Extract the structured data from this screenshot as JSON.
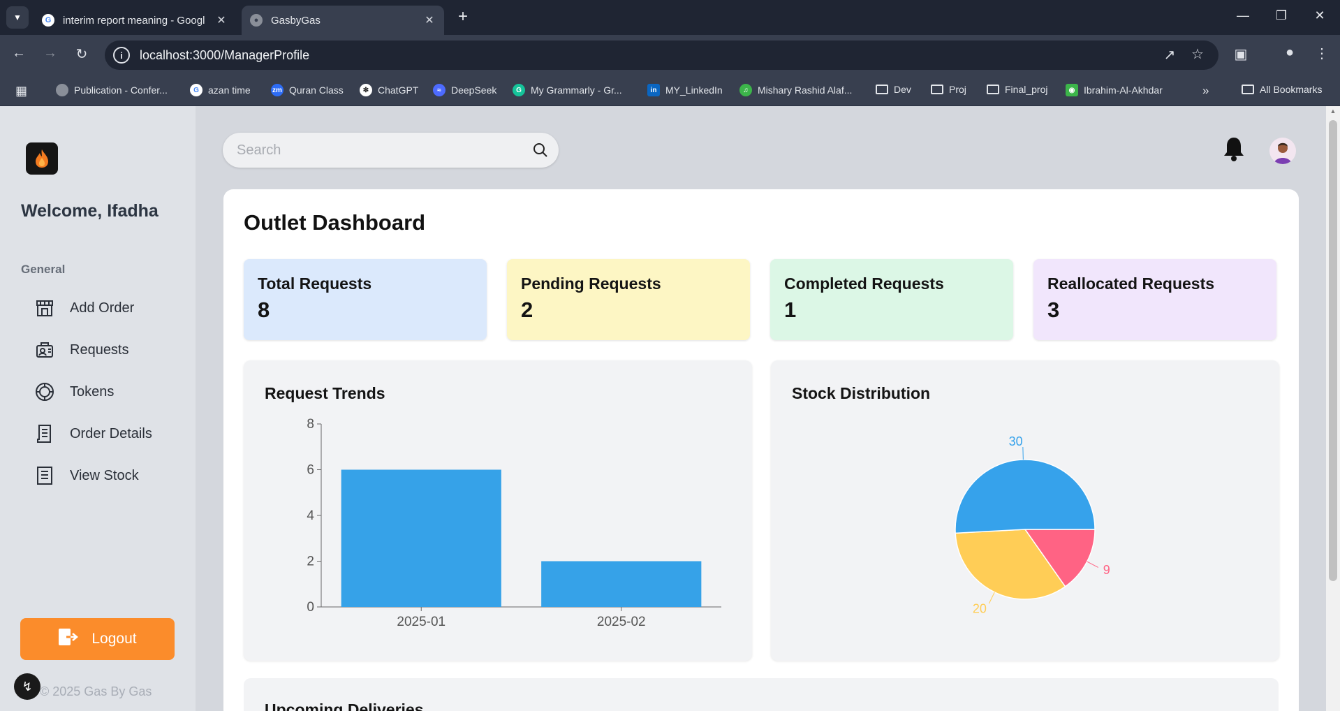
{
  "browser": {
    "tabs": [
      {
        "title": "interim report meaning - Googl",
        "active": false
      },
      {
        "title": "GasbyGas",
        "active": true
      }
    ],
    "url": "localhost:3000/ManagerProfile",
    "bookmarks": [
      "Publication - Confer...",
      "azan time",
      "Quran Class",
      "ChatGPT",
      "DeepSeek",
      "My Grammarly - Gr...",
      "MY_LinkedIn",
      "Mishary Rashid Alaf...",
      "Dev",
      "Proj",
      "Final_proj",
      "Ibrahim-Al-Akhdar"
    ],
    "all_bookmarks": "All Bookmarks"
  },
  "sidebar": {
    "welcome": "Welcome, Ifadha",
    "section": "General",
    "items": [
      {
        "label": "Add Order",
        "icon": "store-icon"
      },
      {
        "label": "Requests",
        "icon": "requests-icon"
      },
      {
        "label": "Tokens",
        "icon": "token-icon"
      },
      {
        "label": "Order Details",
        "icon": "order-list-icon"
      },
      {
        "label": "View Stock",
        "icon": "stock-list-icon"
      }
    ],
    "logout": "Logout",
    "copyright": "© 2025 Gas By Gas"
  },
  "header": {
    "search_placeholder": "Search"
  },
  "dashboard": {
    "title": "Outlet Dashboard",
    "stats": [
      {
        "label": "Total Requests",
        "value": "8",
        "color": "#dbe9fc"
      },
      {
        "label": "Pending Requests",
        "value": "2",
        "color": "#fdf6c4"
      },
      {
        "label": "Completed Requests",
        "value": "1",
        "color": "#dcf7e6"
      },
      {
        "label": "Reallocated Requests",
        "value": "3",
        "color": "#f1e6fc"
      }
    ],
    "trends_title": "Request Trends",
    "stock_title": "Stock Distribution",
    "upcoming_title": "Upcoming Deliveries"
  },
  "chart_data": [
    {
      "type": "bar",
      "title": "Request Trends",
      "categories": [
        "2025-01",
        "2025-02"
      ],
      "values": [
        6,
        2
      ],
      "yticks": [
        0,
        2,
        4,
        6,
        8
      ],
      "ylim": [
        0,
        8
      ],
      "color": "#36a2e8",
      "grid": false
    },
    {
      "type": "pie",
      "title": "Stock Distribution",
      "values": [
        9,
        20,
        30
      ],
      "colors": [
        "#ff6384",
        "#ffcd56",
        "#36a2eb"
      ]
    }
  ]
}
